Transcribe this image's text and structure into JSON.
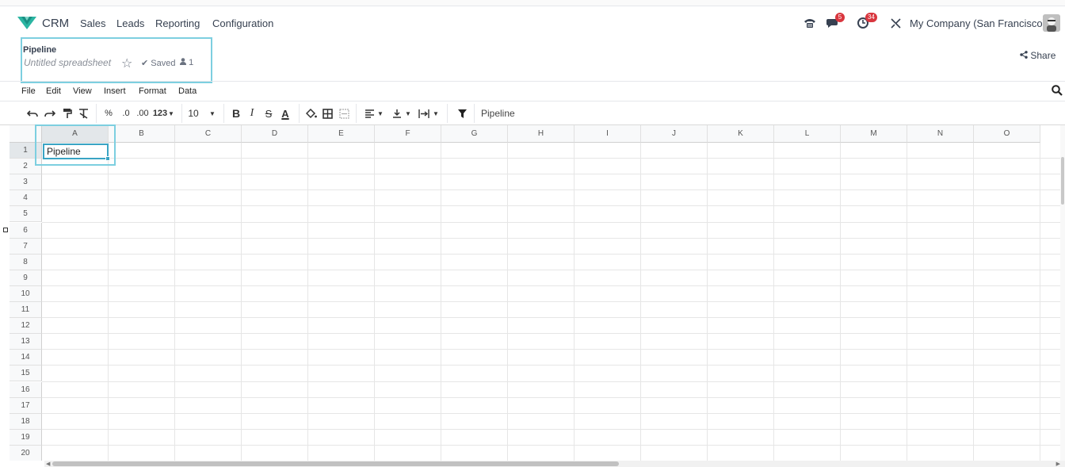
{
  "navbar": {
    "app_name": "CRM",
    "menu": [
      "Sales",
      "Leads",
      "Reporting",
      "Configuration"
    ],
    "messages_badge": "5",
    "activities_badge": "34",
    "company": "My Company (San Francisco)"
  },
  "breadcrumb": {
    "parent": "Pipeline",
    "name": "Untitled spreadsheet",
    "saved_label": "Saved",
    "users_count": "1"
  },
  "share_label": "Share",
  "menubar": [
    "File",
    "Edit",
    "View",
    "Insert",
    "Format",
    "Data"
  ],
  "toolbar": {
    "percent": "%",
    "dec_decrease": ".0",
    "dec_increase": ".00",
    "number_format": "123",
    "font_size": "10",
    "bold": "B",
    "italic": "I",
    "strike": "S",
    "text_color": "A"
  },
  "formula_bar_value": "Pipeline",
  "sheet": {
    "columns": [
      "A",
      "B",
      "C",
      "D",
      "E",
      "F",
      "G",
      "H",
      "I",
      "J",
      "K",
      "L",
      "M",
      "N",
      "O"
    ],
    "rows": [
      "1",
      "2",
      "3",
      "4",
      "5",
      "6",
      "7",
      "8",
      "9",
      "10",
      "11",
      "12",
      "13",
      "14",
      "15",
      "16",
      "17",
      "18",
      "19",
      "20"
    ],
    "selected_cell": "A1",
    "cell_a1": "Pipeline"
  },
  "colors": {
    "highlight": "#7dcfe0",
    "selection": "#3aa4c4",
    "badge": "#d9363e",
    "logo": "#2bb5a2"
  }
}
